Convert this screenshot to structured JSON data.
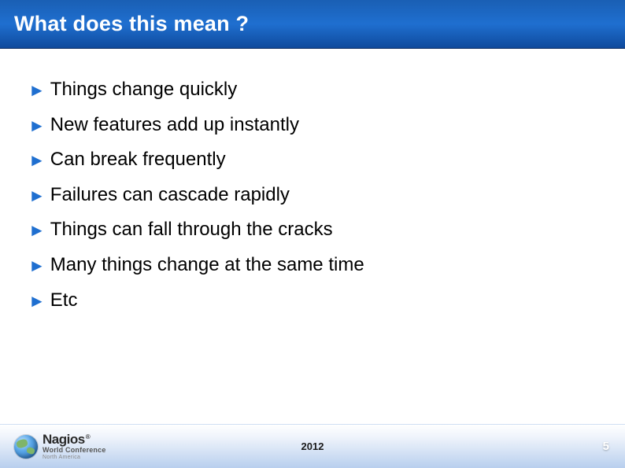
{
  "title": "What does this mean ?",
  "bullets": [
    "Things change quickly",
    "New features add up instantly",
    "Can break frequently",
    "Failures can cascade rapidly",
    "Things can fall through the cracks",
    "Many things change at the same time",
    "Etc"
  ],
  "footer": {
    "brand_main": "Nagios",
    "brand_reg": "®",
    "brand_sub": "World Conference",
    "brand_sub2": "North America",
    "year": "2012",
    "page": "5"
  }
}
